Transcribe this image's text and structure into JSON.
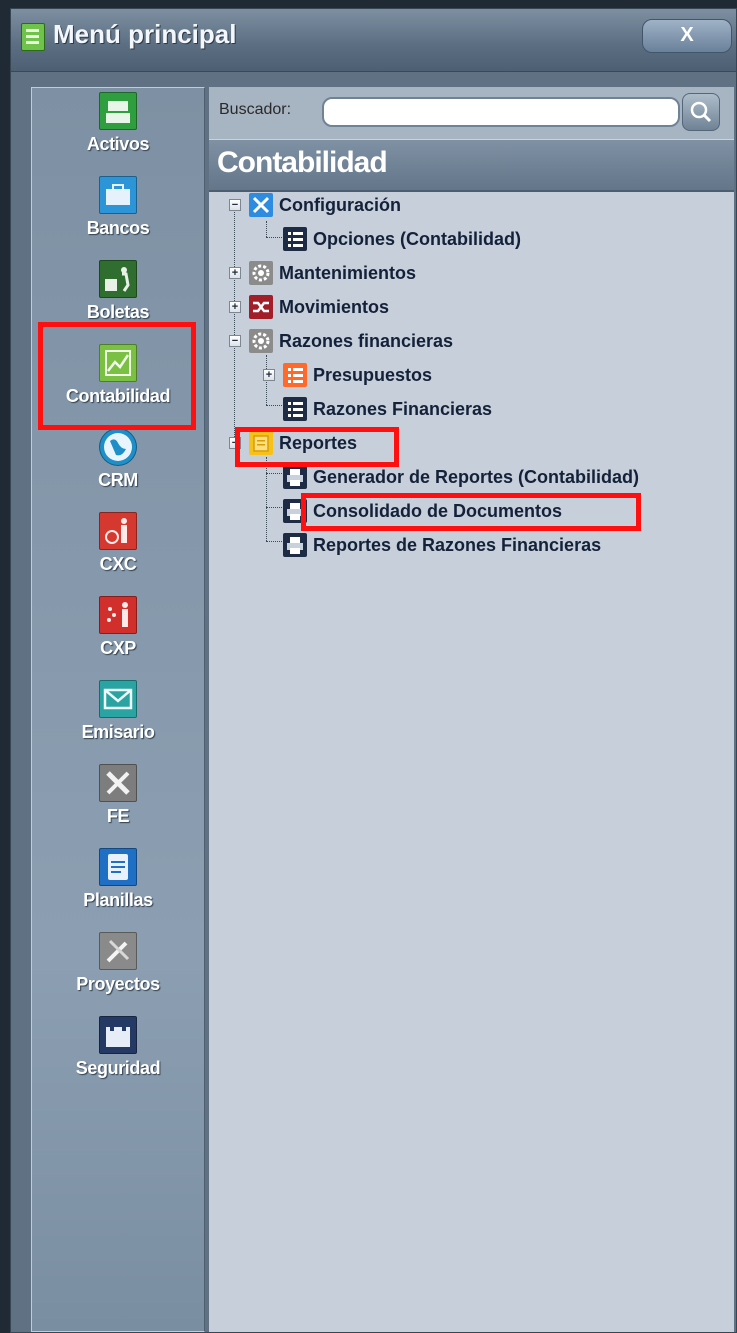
{
  "window": {
    "title": "Menú principal",
    "close_label": "X"
  },
  "sidebar": {
    "items": [
      {
        "label": "Activos",
        "icon": "cash-register-icon",
        "color": "#2e9e3e"
      },
      {
        "label": "Bancos",
        "icon": "briefcase-icon",
        "color": "#2b95d8"
      },
      {
        "label": "Boletas",
        "icon": "delivery-icon",
        "color": "#2f6e2f"
      },
      {
        "label": "Contabilidad",
        "icon": "chart-icon",
        "color": "#79c043"
      },
      {
        "label": "CRM",
        "icon": "globe-icon",
        "color": "#1e8fc8"
      },
      {
        "label": "CXC",
        "icon": "person-money-icon",
        "color": "#d4382f"
      },
      {
        "label": "CXP",
        "icon": "person-coins-icon",
        "color": "#d12f2b"
      },
      {
        "label": "Emisario",
        "icon": "envelope-icon",
        "color": "#2aa3a3"
      },
      {
        "label": "FE",
        "icon": "tools-icon",
        "color": "#7d7d7d"
      },
      {
        "label": "Planillas",
        "icon": "document-icon",
        "color": "#1f6fc4"
      },
      {
        "label": "Proyectos",
        "icon": "pencil-ruler-icon",
        "color": "#8a8a8a"
      },
      {
        "label": "Seguridad",
        "icon": "castle-icon",
        "color": "#243a64"
      }
    ],
    "selected": "Contabilidad"
  },
  "search": {
    "label": "Buscador:",
    "value": "",
    "placeholder": ""
  },
  "section": {
    "title": "Contabilidad"
  },
  "tree": {
    "nodes": [
      {
        "label": "Configuración",
        "icon": "wrench-screwdriver-icon"
      },
      {
        "label": "Opciones (Contabilidad)",
        "icon": "list-icon"
      },
      {
        "label": "Mantenimientos",
        "icon": "gear-icon"
      },
      {
        "label": "Movimientos",
        "icon": "shuffle-icon"
      },
      {
        "label": "Razones financieras",
        "icon": "gear-icon"
      },
      {
        "label": "Presupuestos",
        "icon": "list-icon"
      },
      {
        "label": "Razones Financieras",
        "icon": "list-icon"
      },
      {
        "label": "Reportes",
        "icon": "folder-icon"
      },
      {
        "label": "Generador de Reportes (Contabilidad)",
        "icon": "printer-icon"
      },
      {
        "label": "Consolidado de Documentos",
        "icon": "printer-icon"
      },
      {
        "label": "Reportes de Razones Financieras",
        "icon": "printer-icon"
      }
    ]
  },
  "colors": {
    "highlight": "#ff1010",
    "accent_orange": "#ff6a2b",
    "folder_yellow": "#f6c21a"
  }
}
